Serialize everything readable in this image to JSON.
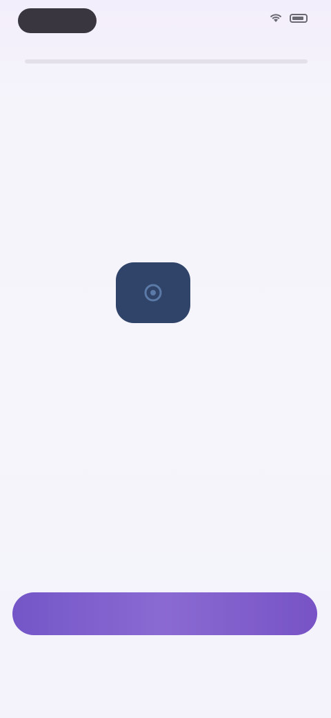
{
  "status_bar": {
    "time": "",
    "icons": [
      "wifi-icon",
      "battery-icon"
    ]
  },
  "app": {
    "logo_icon": "app-logo-icon",
    "name": "",
    "description_line1": "",
    "description_line2": ""
  },
  "actions": {
    "primary_label": ""
  },
  "footer": {
    "text": "",
    "link_label": ""
  },
  "colors": {
    "primary": "#7b5ccc",
    "logo_bg": "#2f4468",
    "background": "#f5f4fb"
  }
}
